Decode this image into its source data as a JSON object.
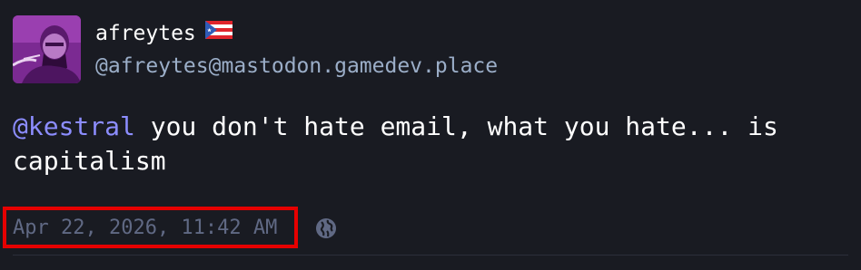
{
  "account": {
    "display_name": "afreytes",
    "acct": "@afreytes@mastodon.gamedev.place"
  },
  "status": {
    "mention": "@kestral",
    "text": " you don't hate email, what you hate... is capitalism",
    "timestamp": "Apr 22, 2026, 11:42 AM",
    "separator": "·",
    "visibility_icon": "globe-icon"
  },
  "colors": {
    "background": "#191b22",
    "mention": "#8c8dff",
    "muted": "#606984",
    "acct": "#9baec8",
    "highlight_box": "#e60000"
  },
  "icons": {
    "flag": "puerto-rico-flag-icon",
    "visibility": "globe-icon"
  }
}
